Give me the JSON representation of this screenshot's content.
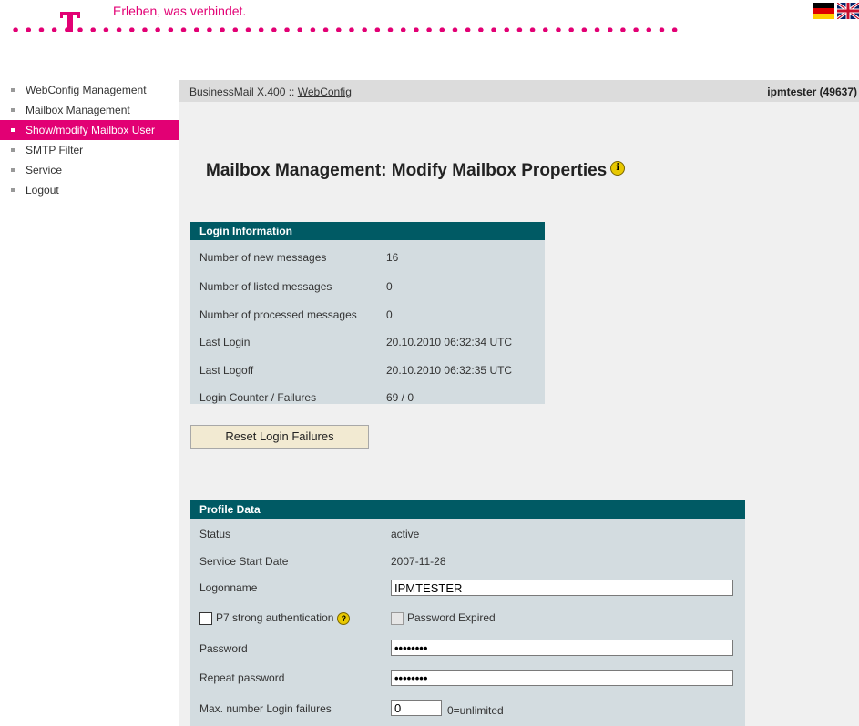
{
  "header": {
    "slogan": "Erleben, was verbindet.",
    "brand_color": "#e20074",
    "logo_icon": "telekom-t-icon",
    "flags": [
      "german-flag-icon",
      "uk-flag-icon"
    ]
  },
  "sidebar": {
    "items": [
      {
        "label": "WebConfig Management"
      },
      {
        "label": "Mailbox Management"
      },
      {
        "label": "Show/modify Mailbox User"
      },
      {
        "label": "SMTP Filter"
      },
      {
        "label": "Service"
      },
      {
        "label": "Logout"
      }
    ]
  },
  "breadcrumb": {
    "prefix": "BusinessMail X.400 ::",
    "link": "WebConfig"
  },
  "user": {
    "id": "ipmtester (49637)"
  },
  "page": {
    "title": "Mailbox Management: Modify Mailbox Properties"
  },
  "login_info": {
    "header": "Login Information",
    "rows": [
      {
        "label": "Number of new messages",
        "value": "16"
      },
      {
        "label": "Number of listed messages",
        "value": "0"
      },
      {
        "label": "Number of processed messages",
        "value": "0"
      },
      {
        "label": "Last Login",
        "value": "20.10.2010 06:32:34 UTC"
      },
      {
        "label": "Last Logoff",
        "value": "20.10.2010 06:32:35 UTC"
      },
      {
        "label": "Login Counter / Failures",
        "value": "69 / 0"
      }
    ],
    "reset_button": "Reset Login Failures"
  },
  "profile": {
    "header": "Profile Data",
    "status_label": "Status",
    "status_value": "active",
    "start_label": "Service Start Date",
    "start_value": "2007-11-28",
    "logon_label": "Logonname",
    "logon_value": "IPMTESTER",
    "p7_label": "P7 strong authentication",
    "pw_expired_label": "Password Expired",
    "password_label": "Password",
    "password_value": "••••••••",
    "repeat_label": "Repeat password",
    "repeat_value": "••••••••",
    "max_fail_label": "Max. number Login failures",
    "max_fail_value": "0",
    "max_fail_hint": "0=unlimited"
  }
}
